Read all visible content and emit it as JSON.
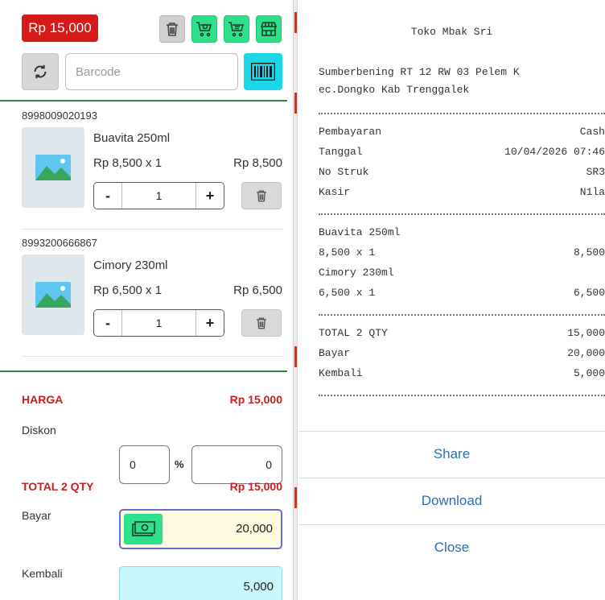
{
  "cart": {
    "total_badge": "Rp 15,000",
    "barcode_placeholder": "Barcode",
    "items": [
      {
        "code": "8998009020193",
        "name": "Buavita 250ml",
        "price_line": "Rp 8,500  x  1",
        "subtotal": "Rp 8,500",
        "qty": "1"
      },
      {
        "code": "8993200666867",
        "name": "Cimory 230ml",
        "price_line": "Rp 6,500  x  1",
        "subtotal": "Rp 6,500",
        "qty": "1"
      }
    ],
    "stepper": {
      "minus": "-",
      "plus": "+"
    }
  },
  "summary": {
    "harga_label": "HARGA",
    "harga_value": "Rp 15,000",
    "diskon_label": "Diskon",
    "diskon_pct": "0",
    "pct_symbol": "%",
    "diskon_amount": "0",
    "total_label": "TOTAL 2 QTY",
    "total_value": "Rp 15,000",
    "bayar_label": "Bayar",
    "bayar_value": "20,000",
    "kembali_label": "Kembali",
    "kembali_value": "5,000"
  },
  "receipt": {
    "store_name": "Toko Mbak Sri",
    "address_line1": "Sumberbening RT 12 RW 03 Pelem K",
    "address_line2": "ec.Dongko Kab Trenggalek",
    "rows_info": [
      {
        "label": "Pembayaran",
        "value": "Cash"
      },
      {
        "label": "Tanggal",
        "value": "10/04/2026 07:46"
      },
      {
        "label": "No Struk",
        "value": "SR3"
      },
      {
        "label": "Kasir",
        "value": "N1la"
      }
    ],
    "items": [
      {
        "name": "Buavita 250ml",
        "qty_line": "8,500 x 1",
        "amount": "8,500"
      },
      {
        "name": "Cimory 230ml",
        "qty_line": "6,500 x 1",
        "amount": "6,500"
      }
    ],
    "rows_totals": [
      {
        "label": "TOTAL 2 QTY",
        "value": "15,000"
      },
      {
        "label": "Bayar",
        "value": "20,000"
      },
      {
        "label": "Kembali",
        "value": "5,000"
      }
    ]
  },
  "actions": {
    "share": "Share",
    "download": "Download",
    "close": "Close"
  },
  "colors": {
    "red": "#d51a1a",
    "green": "#2fe08a",
    "cyan": "#1ad6e6",
    "link": "#2b6fb3",
    "divider_green": "#2e8b3a"
  }
}
